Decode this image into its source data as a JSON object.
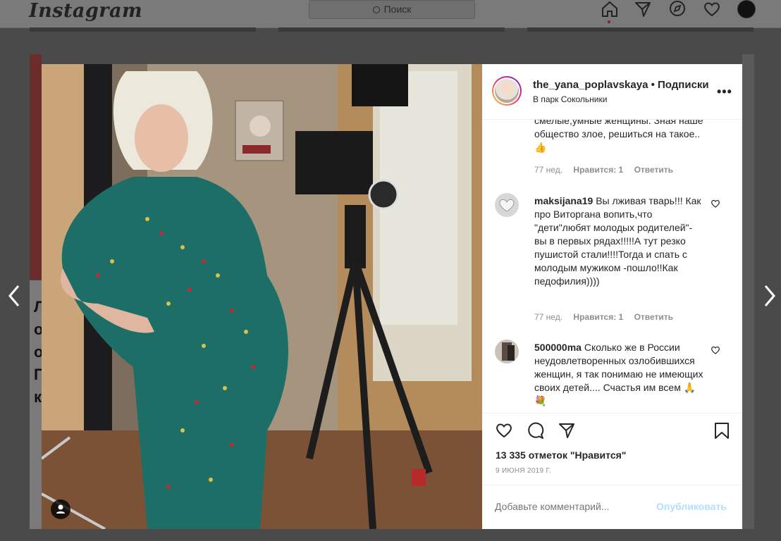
{
  "app": {
    "logo": "Instagram"
  },
  "nav": {
    "search_placeholder": "Поиск",
    "icons": [
      "home-icon",
      "direct-icon",
      "explore-icon",
      "heart-icon",
      "profile-avatar"
    ]
  },
  "background_text": [
    "Л",
    "о",
    "о",
    "П",
    "к"
  ],
  "post": {
    "username": "the_yana_poplavskaya",
    "follow_label": "• Подписки",
    "location": "В парк Сокольники",
    "more_icon": "more-dots-icon",
    "comments": [
      {
        "user": "",
        "text": "смелые,умные женщины. Зная наше общество злое, решиться на такое..👍",
        "time": "77 нед.",
        "likes": "Нравится: 1",
        "reply": "Ответить"
      },
      {
        "user": "maksijana19",
        "text": "Вы лживая тварь!!! Как про Виторгана вопить,что \"дети\"любят молодых родителей\"-вы в первых рядах!!!!!А тут резко пушистой стали!!!!Тогда и спать с молодым мужиком -пошло!!Как педофилия))))",
        "time": "77 нед.",
        "likes": "Нравится: 1",
        "reply": "Ответить"
      },
      {
        "user": "500000ma",
        "text": "Сколько же в России неудовлетворенных озлобившихся женщин, я так понимаю не имеющих своих детей.... Счастья им всем 🙏💐",
        "time": "",
        "likes": "",
        "reply": ""
      }
    ],
    "likes_count": "13 335 отметок \"Нравится\"",
    "date": "9 ИЮНЯ 2019 Г.",
    "comment_placeholder": "Добавьте комментарий...",
    "publish_label": "Опубликовать"
  },
  "colors": {
    "accent": "#0095f6",
    "publish_disabled": "#b2dffc",
    "text": "#262626",
    "muted": "#8e8e8e"
  }
}
